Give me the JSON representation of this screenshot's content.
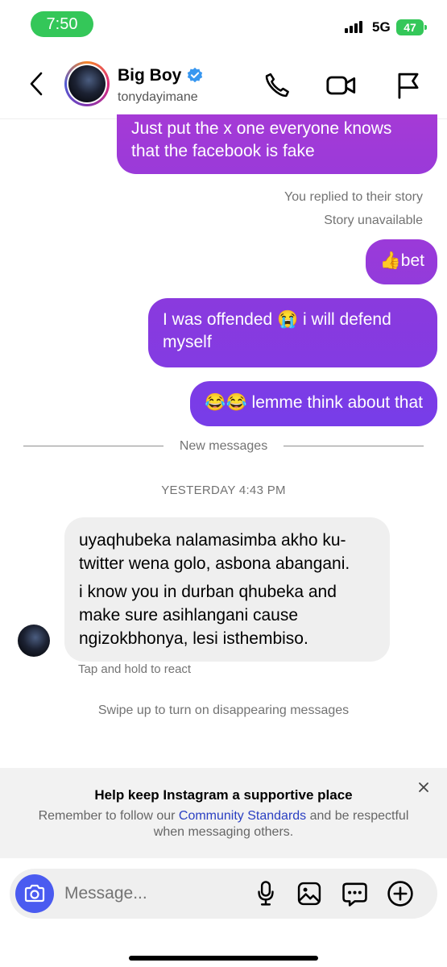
{
  "status": {
    "time": "7:50",
    "network": "5G",
    "battery": "47"
  },
  "header": {
    "name": "Big Boy",
    "username": "tonydayimane",
    "icons": [
      "back-icon",
      "verified-icon",
      "phone-icon",
      "video-icon",
      "flag-icon"
    ]
  },
  "messages": {
    "out1": "Just put the x one everyone knows that the facebook is fake",
    "replied_story": "You replied to their story",
    "story_unavailable": "Story unavailable",
    "out2": "👍bet",
    "out3": "I was offended 😭 i will defend myself",
    "out4": "😂😂 lemme think about that"
  },
  "divider": {
    "label": "New messages"
  },
  "timestamp": "YESTERDAY 4:43 PM",
  "incoming": {
    "line1": "uyaqhubeka nalamasimba akho ku-twitter wena golo, asbona abangani.",
    "line2": "i know you in durban qhubeka and make sure asihlangani cause ngizokbhonya, lesi isthembiso."
  },
  "hint": "Tap and hold to react",
  "swipe": "Swipe up to turn on disappearing messages",
  "notice": {
    "title": "Help keep Instagram a supportive place",
    "text_before": "Remember to follow our ",
    "link": "Community Standards",
    "text_after": " and be respectful when messaging others."
  },
  "composer": {
    "placeholder": "Message...",
    "icons": [
      "camera-icon",
      "microphone-icon",
      "gallery-icon",
      "sticker-icon",
      "add-icon"
    ]
  },
  "colors": {
    "accent": "#4a5bf0",
    "bubble_top": "#a53bd6",
    "bubble_bottom": "#7a3ce8",
    "incoming_bubble": "#efefef",
    "link": "#2a3fc2"
  }
}
